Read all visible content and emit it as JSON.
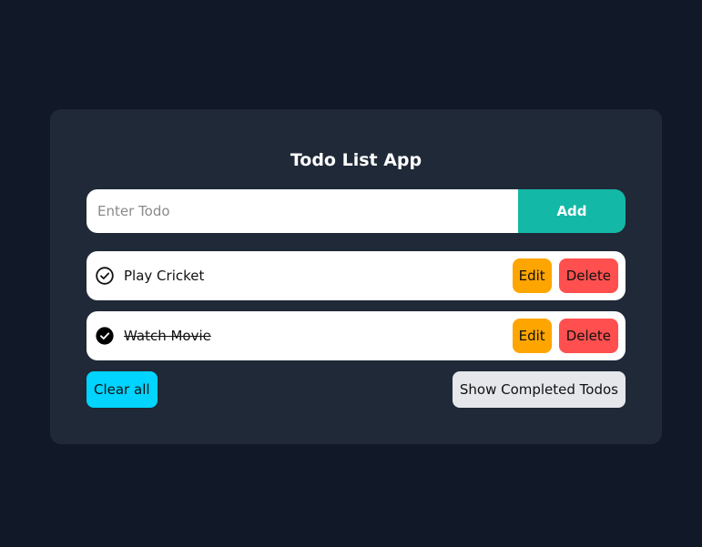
{
  "app": {
    "title": "Todo List App"
  },
  "input": {
    "placeholder": "Enter Todo",
    "value": "",
    "add_label": "Add"
  },
  "todos": [
    {
      "text": "Play Cricket",
      "completed": false,
      "edit_label": "Edit",
      "delete_label": "Delete"
    },
    {
      "text": "Watch Movie",
      "completed": true,
      "edit_label": "Edit",
      "delete_label": "Delete"
    }
  ],
  "footer": {
    "clear_label": "Clear all",
    "show_completed_label": "Show Completed Todos"
  },
  "colors": {
    "background": "#111827",
    "card": "#1f2937",
    "add": "#14b8a6",
    "edit": "#ffa500",
    "delete": "#ff4f4f",
    "clear": "#00d4ff",
    "show": "#e5e7eb"
  },
  "icons": {
    "unchecked": "circle-check-outline-icon",
    "checked": "circle-check-filled-icon"
  }
}
